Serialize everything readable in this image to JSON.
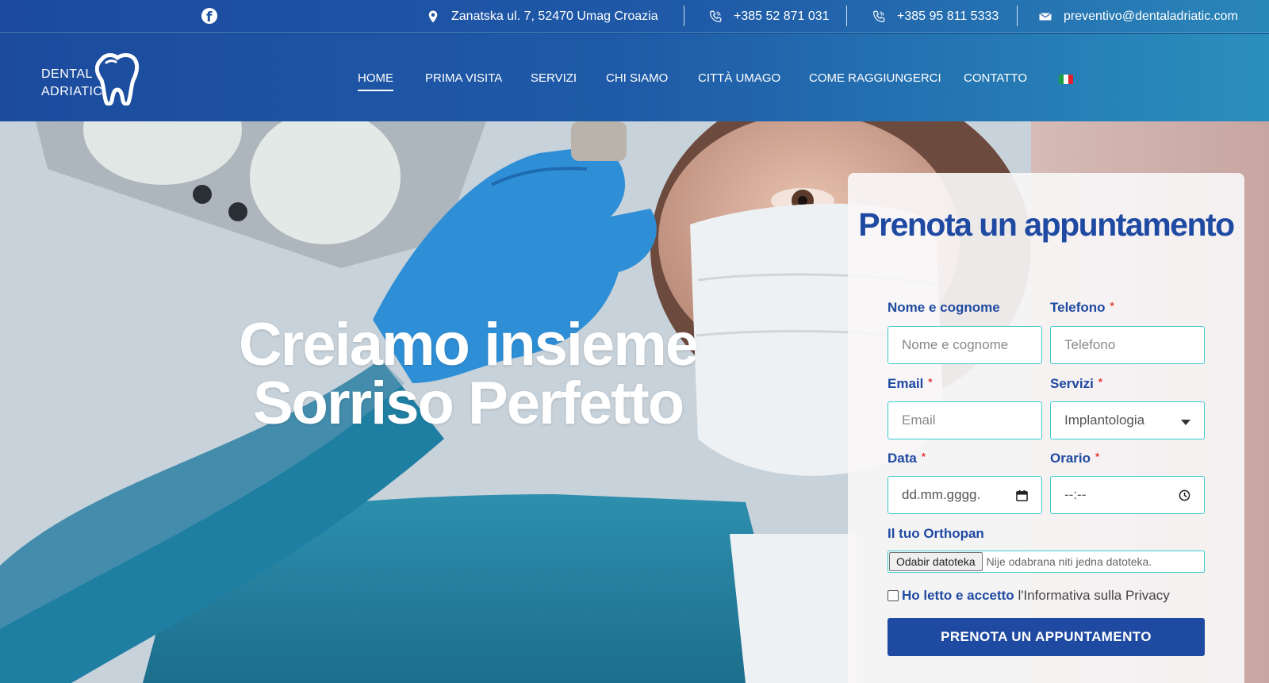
{
  "topbar": {
    "address": "Zanatska ul. 7, 52470 Umag Croazia",
    "phone1": "+385 52 871 031",
    "phone2": "+385 95 811 5333",
    "email": "preventivo@dentaladriatic.com"
  },
  "logo": {
    "line1": "DENTAL",
    "line2": "ADRIATIC"
  },
  "nav": {
    "items": [
      "HOME",
      "PRIMA VISITA",
      "SERVIZI",
      "CHI SIAMO",
      "CITTÀ UMAGO",
      "COME RAGGIUNGERCI",
      "CONTATTO"
    ],
    "active": "HOME",
    "flag_colors": [
      "#1c9e48",
      "#ffffff",
      "#e2202a"
    ]
  },
  "hero": {
    "title_line1": "Creiamo insieme",
    "title_line2": "Sorriso Perfetto"
  },
  "form": {
    "title": "Prenota un appuntamento",
    "name_label": "Nome e cognome",
    "name_placeholder": "Nome e cognome",
    "phone_label": "Telefono",
    "phone_placeholder": "Telefono",
    "email_label": "Email",
    "email_placeholder": "Email",
    "service_label": "Servizi",
    "service_value": "Implantologia",
    "date_label": "Data",
    "date_placeholder": "dd.mm.gggg.",
    "time_label": "Orario",
    "time_placeholder": "--:--",
    "file_label": "Il tuo Orthopan",
    "file_button": "Odabir datoteka",
    "file_status": "Nije odabrana niti jedna datoteka.",
    "privacy_link": "Ho letto e accetto",
    "privacy_text": "l'Informativa sulla Privacy",
    "submit": "PRENOTA UN APPUNTAMENTO",
    "required_mark": "*"
  },
  "colors": {
    "brand_blue": "#1f4aa2",
    "accent_teal": "#3ecbd0",
    "required_red": "#e53434"
  }
}
